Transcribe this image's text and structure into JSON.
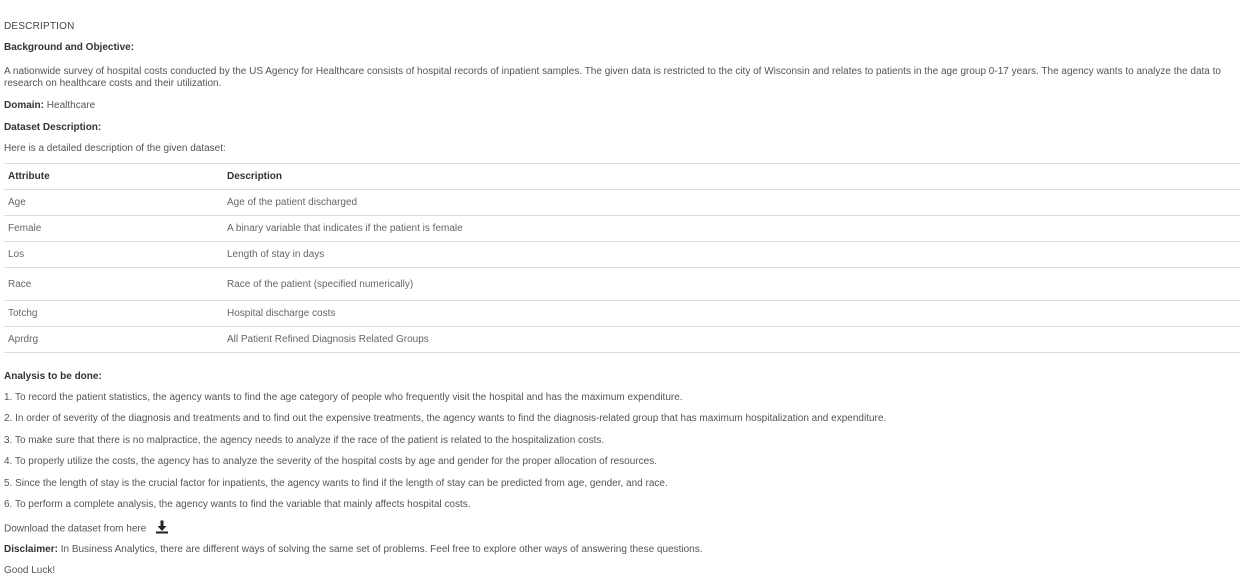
{
  "section_title": "DESCRIPTION",
  "background": {
    "heading": "Background and Objective:",
    "text": "A nationwide survey of hospital costs conducted by the US Agency for Healthcare consists of hospital records of inpatient samples. The given data is restricted to the city of Wisconsin and relates to patients in the age group 0-17 years. The agency wants to analyze the data to research on healthcare costs and their utilization."
  },
  "domain": {
    "label": "Domain:",
    "value": "Healthcare"
  },
  "dataset": {
    "heading": "Dataset Description:",
    "intro": "Here is a detailed description of the given dataset:",
    "columns": [
      "Attribute",
      "Description"
    ],
    "rows": [
      [
        "Age",
        "Age of the patient discharged"
      ],
      [
        "Female",
        "A binary variable that indicates if the patient is female"
      ],
      [
        "Los",
        "Length of stay in days"
      ],
      [
        "Race",
        "Race of the patient (specified numerically)"
      ],
      [
        "Totchg",
        "Hospital discharge costs"
      ],
      [
        "Aprdrg",
        "All Patient Refined Diagnosis Related Groups"
      ]
    ]
  },
  "analysis": {
    "heading": "Analysis to be done:",
    "items": [
      "1. To record the patient statistics, the agency wants to find the age category of people who frequently visit the hospital and has the maximum expenditure.",
      "2. In order of severity of the diagnosis and treatments and to find out the expensive treatments, the agency wants to find the diagnosis-related group that has maximum hospitalization and expenditure.",
      "3. To make sure that there is no malpractice, the agency needs to analyze if the race of the patient is related to the hospitalization costs.",
      "4. To properly utilize the costs, the agency has to analyze the severity of the hospital costs by age and gender for the proper allocation of resources.",
      "5. Since the length of stay is the crucial factor for inpatients, the agency wants to find if the length of stay can be predicted from age, gender, and race.",
      "6. To perform a complete analysis, the agency wants to find the variable that mainly affects hospital costs."
    ]
  },
  "download": {
    "text": "Download the dataset from here",
    "icon": "download-icon"
  },
  "disclaimer": {
    "label": "Disclaimer:",
    "text": "In Business Analytics, there are different ways of solving the same set of problems. Feel free to explore other ways of answering these questions."
  },
  "closing": "Good Luck!"
}
